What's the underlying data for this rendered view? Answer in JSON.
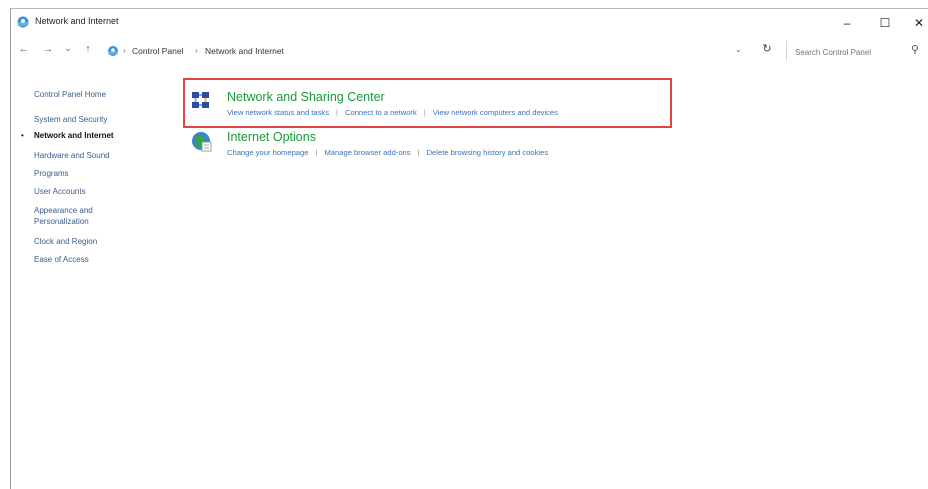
{
  "window": {
    "title": "Network and Internet",
    "minimize": "–",
    "maximize": "☐",
    "close": "✕"
  },
  "nav": {
    "back": "←",
    "forward": "→",
    "recent": "⌄",
    "up": "↑"
  },
  "address": {
    "breadcrumbs": [
      "Control Panel",
      "Network and Internet"
    ],
    "separator": "›",
    "dropdown": "⌄",
    "refresh": "↻",
    "search_placeholder": "Search Control Panel",
    "search_icon": "⚲"
  },
  "sidebar": {
    "home": "Control Panel Home",
    "items": [
      {
        "label": "System and Security"
      },
      {
        "label": "Network and Internet",
        "current": true
      },
      {
        "label": "Hardware and Sound"
      },
      {
        "label": "Programs"
      },
      {
        "label": "User Accounts"
      },
      {
        "label": "Appearance and"
      },
      {
        "label": "Personalization"
      },
      {
        "label": "Clock and Region"
      },
      {
        "label": "Ease of Access"
      }
    ],
    "bullet": "•"
  },
  "categories": [
    {
      "title": "Network and Sharing Center",
      "icon": "network-sharing-center-icon",
      "links": [
        "View network status and tasks",
        "Connect to a network",
        "View network computers and devices"
      ]
    },
    {
      "title": "Internet Options",
      "icon": "internet-options-icon",
      "links": [
        "Change your homepage",
        "Manage browser add-ons",
        "Delete browsing history and cookies"
      ]
    }
  ],
  "colors": {
    "highlight": "#e04545",
    "category_title": "#1a9a3a",
    "link": "#3a74b8"
  }
}
